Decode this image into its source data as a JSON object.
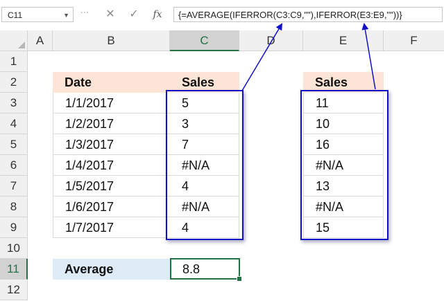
{
  "formula_bar": {
    "name_box": "C11",
    "formula": "{=AVERAGE(IFERROR(C3:C9,\"\"),IFERROR(E3:E9,\"\"))}",
    "icons": {
      "cancel": "close-icon",
      "enter": "check-icon",
      "function": "fx-icon"
    }
  },
  "columns": [
    "A",
    "B",
    "C",
    "D",
    "E",
    "F"
  ],
  "rows": [
    "1",
    "2",
    "3",
    "4",
    "5",
    "6",
    "7",
    "8",
    "9",
    "10",
    "11",
    "12"
  ],
  "table1": {
    "header_date": "Date",
    "header_sales": "Sales",
    "dates": [
      "1/1/2017",
      "1/2/2017",
      "1/3/2017",
      "1/4/2017",
      "1/5/2017",
      "1/6/2017",
      "1/7/2017"
    ],
    "sales": [
      "5",
      "3",
      "7",
      "#N/A",
      "4",
      "#N/A",
      "4"
    ]
  },
  "table2": {
    "header_sales": "Sales",
    "sales": [
      "11",
      "10",
      "16",
      "#N/A",
      "13",
      "#N/A",
      "15"
    ]
  },
  "average": {
    "label": "Average",
    "value": "8.8"
  },
  "colors": {
    "orange_header": "#fce4d6",
    "blue_label": "#ddebf7",
    "highlight": "#1010c8",
    "selection": "#217346"
  }
}
